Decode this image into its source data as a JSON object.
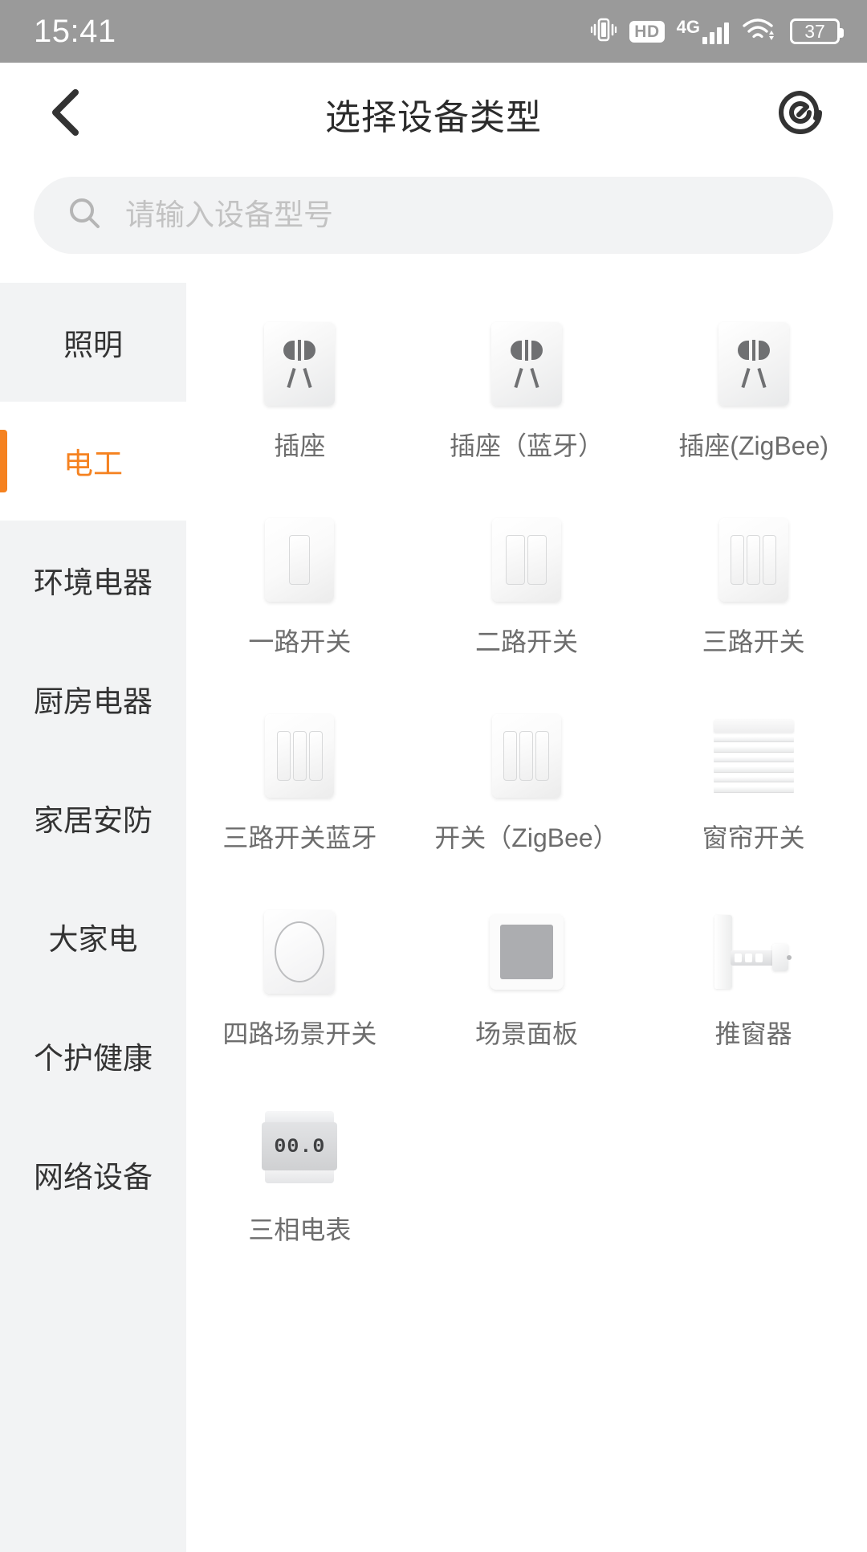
{
  "status_bar": {
    "time": "15:41",
    "hd_label": "HD",
    "network_label": "4G",
    "battery_level": "37",
    "icons": [
      "vibrate-icon",
      "hd-icon",
      "signal-icon",
      "wifi-icon",
      "battery-icon"
    ]
  },
  "app_bar": {
    "back_icon": "chevron-left-icon",
    "title": "选择设备类型",
    "action_icon": "scan-spiral-icon"
  },
  "search": {
    "icon": "search-icon",
    "value": "",
    "placeholder": "请输入设备型号"
  },
  "sidebar": {
    "items": [
      {
        "label": "照明",
        "active": false
      },
      {
        "label": "电工",
        "active": true
      },
      {
        "label": "环境电器",
        "active": false
      },
      {
        "label": "厨房电器",
        "active": false
      },
      {
        "label": "家居安防",
        "active": false
      },
      {
        "label": "大家电",
        "active": false
      },
      {
        "label": "个护健康",
        "active": false
      },
      {
        "label": "网络设备",
        "active": false
      }
    ]
  },
  "devices": [
    {
      "label": "插座",
      "icon": "socket-icon"
    },
    {
      "label": "插座（蓝牙）",
      "icon": "socket-bluetooth-icon"
    },
    {
      "label": "插座(ZigBee)",
      "icon": "socket-zigbee-icon"
    },
    {
      "label": "一路开关",
      "icon": "switch-1gang-icon"
    },
    {
      "label": "二路开关",
      "icon": "switch-2gang-icon"
    },
    {
      "label": "三路开关",
      "icon": "switch-3gang-icon"
    },
    {
      "label": "三路开关蓝牙",
      "icon": "switch-3gang-bluetooth-icon"
    },
    {
      "label": "开关（ZigBee）",
      "icon": "switch-zigbee-icon"
    },
    {
      "label": "窗帘开关",
      "icon": "curtain-switch-icon"
    },
    {
      "label": "四路场景开关",
      "icon": "scene-switch-4gang-icon"
    },
    {
      "label": "场景面板",
      "icon": "scene-panel-icon"
    },
    {
      "label": "推窗器",
      "icon": "window-opener-icon"
    },
    {
      "label": "三相电表",
      "icon": "three-phase-meter-icon"
    }
  ],
  "meter_display": "00.0",
  "colors": {
    "accent": "#f58220",
    "status_bar_bg": "#9a9a9a",
    "sidebar_bg": "#f2f3f4",
    "label_text": "#6d6d6d"
  }
}
